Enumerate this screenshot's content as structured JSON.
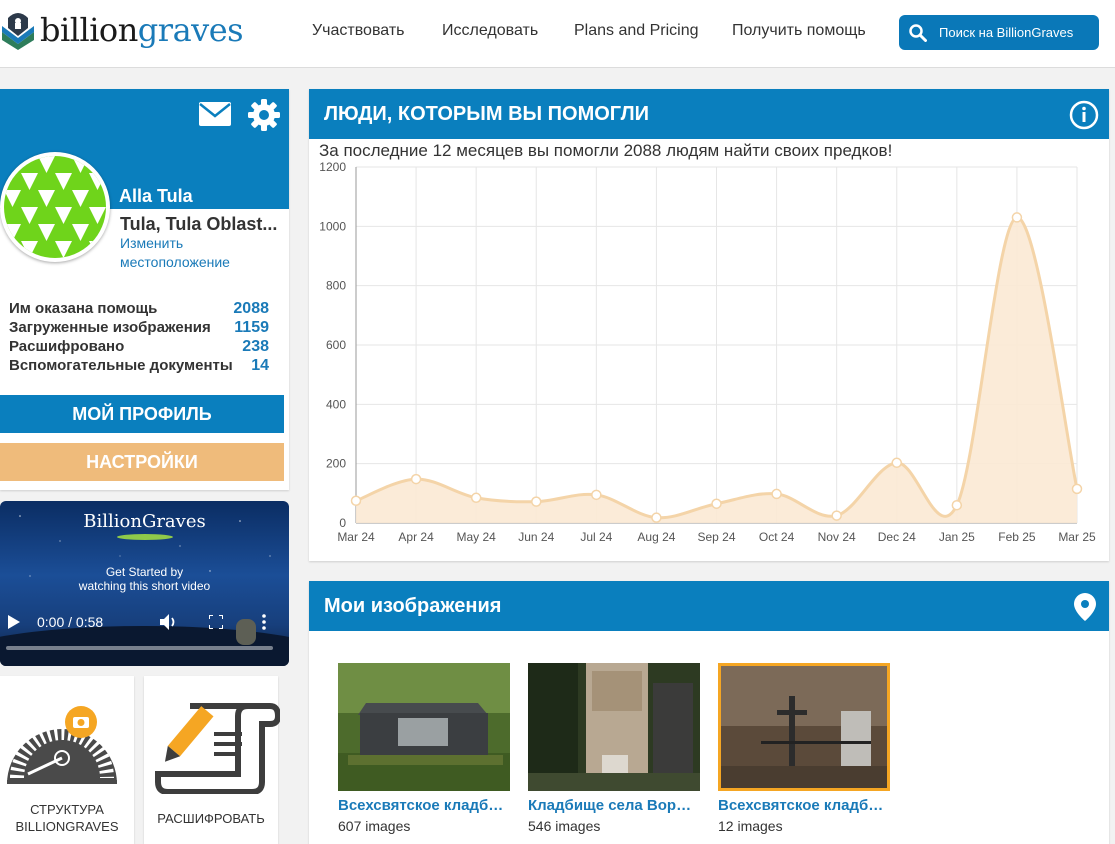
{
  "header": {
    "logo_part1": "billion",
    "logo_part2": "graves",
    "nav": [
      "Участвовать",
      "Исследовать",
      "Plans and Pricing",
      "Получить помощь"
    ],
    "search_label": "Поиск на BillionGraves"
  },
  "profile": {
    "name": "Alla Tula",
    "location": "Tula, Tula Oblast...",
    "change_location": "Изменить местоположение",
    "stats": [
      {
        "label": "Им оказана помощь",
        "value": "2088"
      },
      {
        "label": "Загруженные изображения",
        "value": "1159"
      },
      {
        "label": "Расшифровано",
        "value": "238"
      },
      {
        "label": "Вспомогательные документы",
        "value": "14"
      }
    ],
    "profile_button": "МОЙ ПРОФИЛЬ",
    "settings_button": "НАСТРОЙКИ"
  },
  "video": {
    "brand": "BillionGraves",
    "caption_line1": "Get Started by",
    "caption_line2": "watching this short video",
    "time": "0:00 / 0:58",
    "progress": 0
  },
  "tiles": [
    {
      "line1": "СТРУКТУРА",
      "line2": "BILLIONGRAVES"
    },
    {
      "line1": "РАСШИФРОВАТЬ",
      "line2": ""
    }
  ],
  "helped_panel": {
    "title": "ЛЮДИ, КОТОРЫМ ВЫ ПОМОГЛИ",
    "subtitle": "За последние 12 месяцев вы помогли 2088 людям найти своих предков!"
  },
  "chart_data": {
    "type": "area",
    "categories": [
      "Mar 24",
      "Apr 24",
      "May 24",
      "Jun 24",
      "Jul 24",
      "Aug 24",
      "Sep 24",
      "Oct 24",
      "Nov 24",
      "Dec 24",
      "Jan 25",
      "Feb 25",
      "Mar 25"
    ],
    "values": [
      75,
      148,
      85,
      72,
      95,
      18,
      65,
      98,
      25,
      203,
      60,
      1030,
      115
    ],
    "ylim": [
      0,
      1200
    ],
    "yticks": [
      0,
      200,
      400,
      600,
      800,
      1000,
      1200
    ],
    "grid": true,
    "colors": {
      "line": "#f4d4a8",
      "fill": "#fbe9d4"
    }
  },
  "images_panel": {
    "title": "Мои изображения",
    "items": [
      {
        "title": "Всехсвятское кладбище",
        "count": "607 images"
      },
      {
        "title": "Кладбище села Ворошилово",
        "count": "546 images"
      },
      {
        "title": "Всехсвятское кладбище",
        "count": "12 images"
      }
    ]
  },
  "colors": {
    "brand_blue": "#0a7fbe",
    "accent_orange": "#efbb7b",
    "link_blue": "#1a7ab8"
  }
}
